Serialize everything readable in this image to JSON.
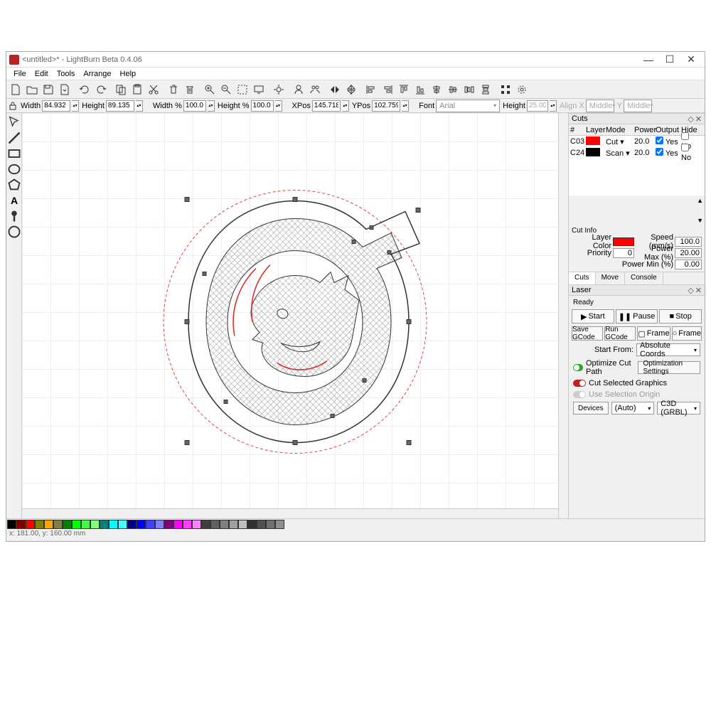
{
  "window": {
    "title": "<untitled>* - LightBurn Beta 0.4.06"
  },
  "menu": {
    "file": "File",
    "edit": "Edit",
    "tools": "Tools",
    "arrange": "Arrange",
    "help": "Help"
  },
  "props": {
    "width_label": "Width",
    "width_val": "84.932",
    "height_label": "Height",
    "height_val": "89.135",
    "width_pct_label": "Width %",
    "width_pct_val": "100.0",
    "height_pct_label": "Height %",
    "height_pct_val": "100.0",
    "xpos_label": "XPos",
    "xpos_val": "145.718",
    "ypos_label": "YPos",
    "ypos_val": "102.759",
    "font_label": "Font",
    "font_val": "Arial",
    "font_height_label": "Height",
    "font_height_val": "25.00",
    "align_x_label": "Align X",
    "align_x_val": "Middle",
    "align_y_label": "Y",
    "align_y_val": "Middle"
  },
  "cuts_panel": {
    "title": "Cuts",
    "hdr_num": "#",
    "hdr_layer": "Layer",
    "hdr_mode": "Mode",
    "hdr_power": "Power",
    "hdr_output": "Output",
    "hdr_hide": "Hide",
    "rows": [
      {
        "num": "C03",
        "color": "#ff0000",
        "mode": "Cut",
        "power": "20.0",
        "output_yes": "Yes",
        "hide_no": "No"
      },
      {
        "num": "C24",
        "color": "#000000",
        "mode": "Scan",
        "power": "20.0",
        "output_yes": "Yes",
        "hide_no": "No"
      }
    ]
  },
  "cut_info": {
    "title": "Cut Info",
    "layer_color_label": "Layer Color",
    "layer_color": "#ff0000",
    "speed_label": "Speed (mm/s)",
    "speed_val": "100.0",
    "priority_label": "Priority",
    "priority_val": "0",
    "power_max_label": "Power Max (%)",
    "power_max_val": "20.00",
    "power_min_label": "Power Min (%)",
    "power_min_val": "0.00"
  },
  "tabs": {
    "cuts": "Cuts",
    "move": "Move",
    "console": "Console"
  },
  "laser": {
    "title": "Laser",
    "status": "Ready",
    "start": "Start",
    "pause": "Pause",
    "stop": "Stop",
    "save_gcode": "Save GCode",
    "run_gcode": "Run GCode",
    "frame1": "Frame",
    "frame2": "Frame",
    "start_from_label": "Start From:",
    "start_from_val": "Absolute Coords",
    "optimize_cut": "Optimize Cut Path",
    "cut_selected": "Cut Selected Graphics",
    "use_selection": "Use Selection Origin",
    "optimization_settings": "Optimization Settings",
    "devices": "Devices",
    "device_sel": "(Auto)",
    "controller": "C3D (GRBL)"
  },
  "status": {
    "coords": "x: 181.00, y: 160.00  mm"
  },
  "palette": [
    "#000000",
    "#800000",
    "#ff0000",
    "#808000",
    "#ffa500",
    "#808040",
    "#008000",
    "#00ff00",
    "#40ff40",
    "#80ff80",
    "#008080",
    "#00ffff",
    "#40ffff",
    "#000080",
    "#0000ff",
    "#4040ff",
    "#8080ff",
    "#800080",
    "#ff00ff",
    "#ff40ff",
    "#ff80ff",
    "#404040",
    "#606060",
    "#808080",
    "#a0a0a0",
    "#c0c0c0",
    "#303030",
    "#505050",
    "#707070",
    "#909090"
  ]
}
